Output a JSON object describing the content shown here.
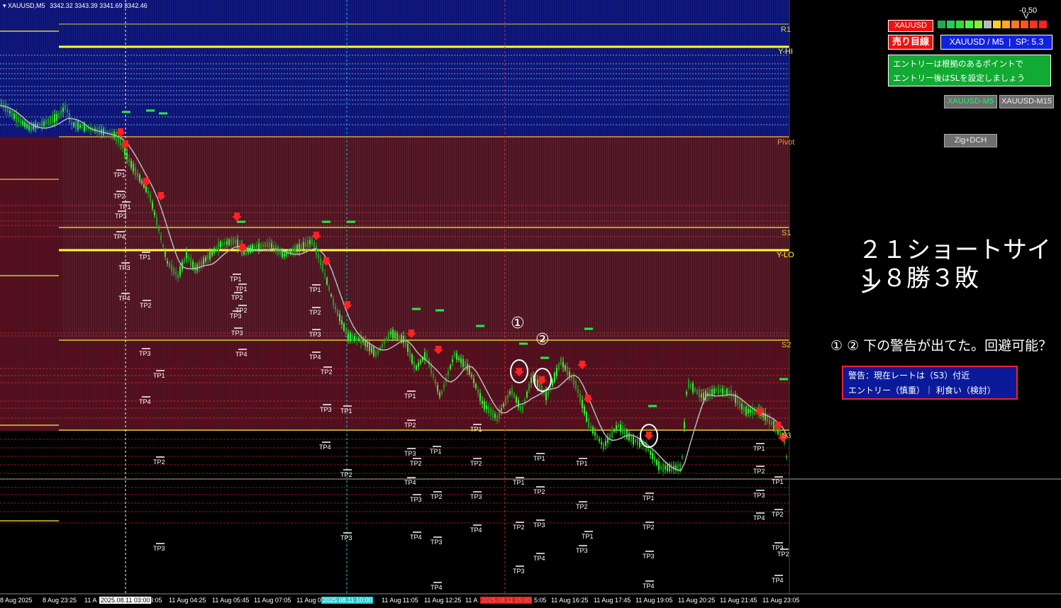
{
  "header": {
    "symbol_tf": "XAUUSD,M5",
    "ohlc": "3342.32 3343.39 3341.69 3342.46"
  },
  "colors": {
    "bull": "#33ee33",
    "bear": "#229922",
    "level": "#d4d12a",
    "yellow": "#ffff33",
    "upper_zone": "#0a0f6e",
    "lower_zone": "#4a0e1c",
    "arrow": "#ff2222"
  },
  "levels": {
    "r1": "R1",
    "yhi": "Y-HI",
    "pivot": "Pivot",
    "s1": "S1",
    "ylo": "Y-LO",
    "s2": "S2",
    "s3": "S3"
  },
  "x_axis": {
    "ticks": [
      "8 Aug 2025",
      "8 Aug 23:25",
      "11 A",
      "3:05",
      "11 Aug 04:25",
      "11 Aug 05:45",
      "11 Aug 07:05",
      "11 Aug 0",
      "11 Aug 11:05",
      "11 Aug 12:25",
      "11 A",
      "5:05",
      "11 Aug 16:25",
      "11 Aug 17:45",
      "11 Aug 19:05",
      "11 Aug 20:25",
      "11 Aug 21:45",
      "11 Aug 23:05"
    ],
    "highlights": [
      {
        "text": "2025.08.11 03:00",
        "bg": "#ffffff",
        "fg": "#000000"
      },
      {
        "text": "2025.08.11 10:00",
        "bg": "#22cccc",
        "fg": "#ffffff"
      },
      {
        "text": "2025.08.11 15:00",
        "bg": "#dd2222",
        "fg": "#ff6666"
      }
    ]
  },
  "panel": {
    "symbol_badge": "XAUUSD",
    "sell_badge": "売り目線",
    "value_readout": "-0.50",
    "info_bar": "XAUUSD / M5  |  SP: 5.3",
    "note_line1": "エントリーは根拠のあるポイントで",
    "note_line2": "エントリー後はSLを設定しましょう",
    "btn_m5": "XAUUSD-M5",
    "btn_m15": "XAUUSD-M15",
    "btn_zig": "Zig+DCH",
    "strength_colors": [
      "#1faa55",
      "#22cc66",
      "#33dd33",
      "#55ee44",
      "#88ee44",
      "#bbbbbb",
      "#ffcc33",
      "#ffaa22",
      "#ff7722",
      "#ff5522",
      "#ff3322",
      "#ff2222"
    ]
  },
  "annotation": {
    "stat_line1": "２１ショートサイン",
    "stat_line2": "１８勝３敗",
    "question": "① ② 下の警告が出てた。回避可能？",
    "marker1": "①",
    "marker2": "②",
    "warn_line1": "警告：現在レートは（S3）付近",
    "warn_line2": "エントリー（慎重）｜ 利食い（検討）"
  },
  "tp_labels": [
    "TP1",
    "TP2",
    "TP3",
    "TP4"
  ]
}
